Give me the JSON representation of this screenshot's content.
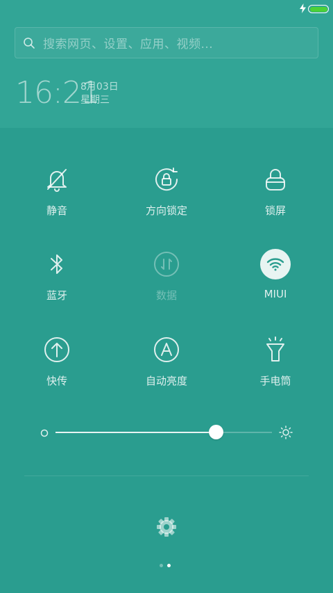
{
  "search": {
    "placeholder": "搜索网页、设置、应用、视频..."
  },
  "clock": {
    "time": "16:21",
    "date": "8月03日",
    "weekday": "星期三"
  },
  "tiles": [
    {
      "label": "静音",
      "icon": "bell-off-icon",
      "enabled": true
    },
    {
      "label": "方向锁定",
      "icon": "rotation-lock-icon",
      "enabled": true
    },
    {
      "label": "锁屏",
      "icon": "lock-icon",
      "enabled": true
    },
    {
      "label": "蓝牙",
      "icon": "bluetooth-icon",
      "enabled": true
    },
    {
      "label": "数据",
      "icon": "mobile-data-icon",
      "enabled": false
    },
    {
      "label": "MIUI",
      "icon": "wifi-icon",
      "enabled": true,
      "active": true
    },
    {
      "label": "快传",
      "icon": "share-upload-icon",
      "enabled": true
    },
    {
      "label": "自动亮度",
      "icon": "auto-brightness-icon",
      "enabled": true
    },
    {
      "label": "手电筒",
      "icon": "flashlight-icon",
      "enabled": true
    }
  ],
  "brightness": {
    "level_percent": 74
  },
  "pager": {
    "pages": 2,
    "current": 2
  },
  "colors": {
    "background": "#2a9d8f",
    "battery": "#4cd137",
    "accent": "#ffffff"
  }
}
